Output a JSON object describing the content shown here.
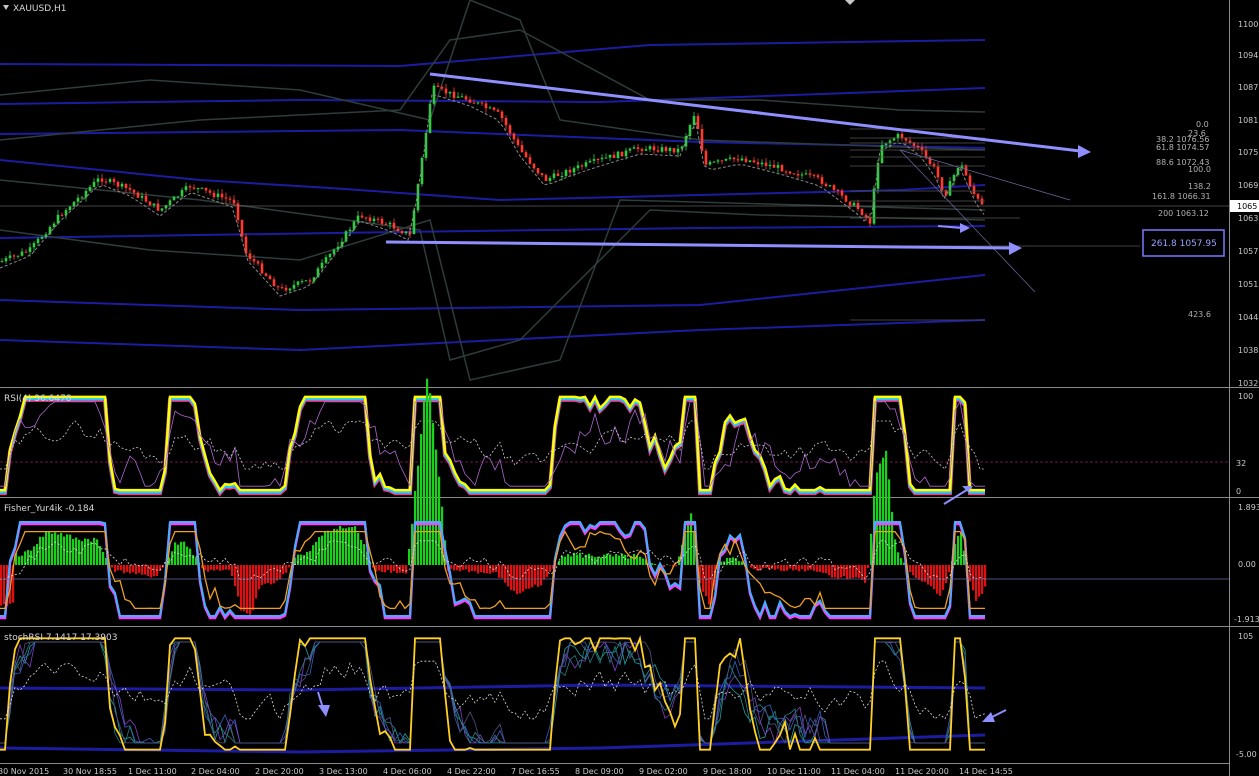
{
  "chart": {
    "symbol_title": "XAUUSD,H1",
    "current_price_label": "1065",
    "price_axis": [
      "1100",
      "1094",
      "1087",
      "1081",
      "1075",
      "1069",
      "1063",
      "1057",
      "1051",
      "1044",
      "1038",
      "1032"
    ]
  },
  "fibonacci": {
    "levels": [
      "0.0",
      "23.6",
      "38.2 1076.56",
      "61.8 1074.57",
      "88.6 1072.43",
      "100.0",
      "138.2",
      "161.8 1066.31",
      "200 1063.12",
      "423.6"
    ],
    "highlighted": "261.8 1057.95"
  },
  "rsi": {
    "title": "RSI(4) 36.6478",
    "axis": [
      "100",
      "32",
      "0"
    ]
  },
  "fisher": {
    "title": "Fisher_Yur4ik -0.184",
    "axis": [
      "1.893",
      "0.00",
      "-1.913"
    ]
  },
  "stochrsi": {
    "title": "stochRSI 7.1417 17.3903",
    "axis": [
      "105",
      "-5.00"
    ]
  },
  "time_axis": [
    "30 Nov 2015",
    "30 Nov 18:55",
    "1 Dec 11:00",
    "2 Dec 04:00",
    "2 Dec 20:00",
    "3 Dec 13:00",
    "4 Dec 06:00",
    "4 Dec 22:00",
    "7 Dec 16:55",
    "8 Dec 09:00",
    "9 Dec 02:00",
    "9 Dec 18:00",
    "10 Dec 11:00",
    "11 Dec 04:00",
    "11 Dec 20:00",
    "14 Dec 14:55"
  ],
  "colors": {
    "background": "#000000",
    "bull_candle": "#2ecc40",
    "bear_candle": "#ff3b2f",
    "trendline": "#8f8fff",
    "bands_blue": "#1c1ca0",
    "bands_gray": "#2e3c3c",
    "rsi_main": "#ffff00",
    "fisher_pos": "#19d119",
    "fisher_neg": "#e01010"
  }
}
